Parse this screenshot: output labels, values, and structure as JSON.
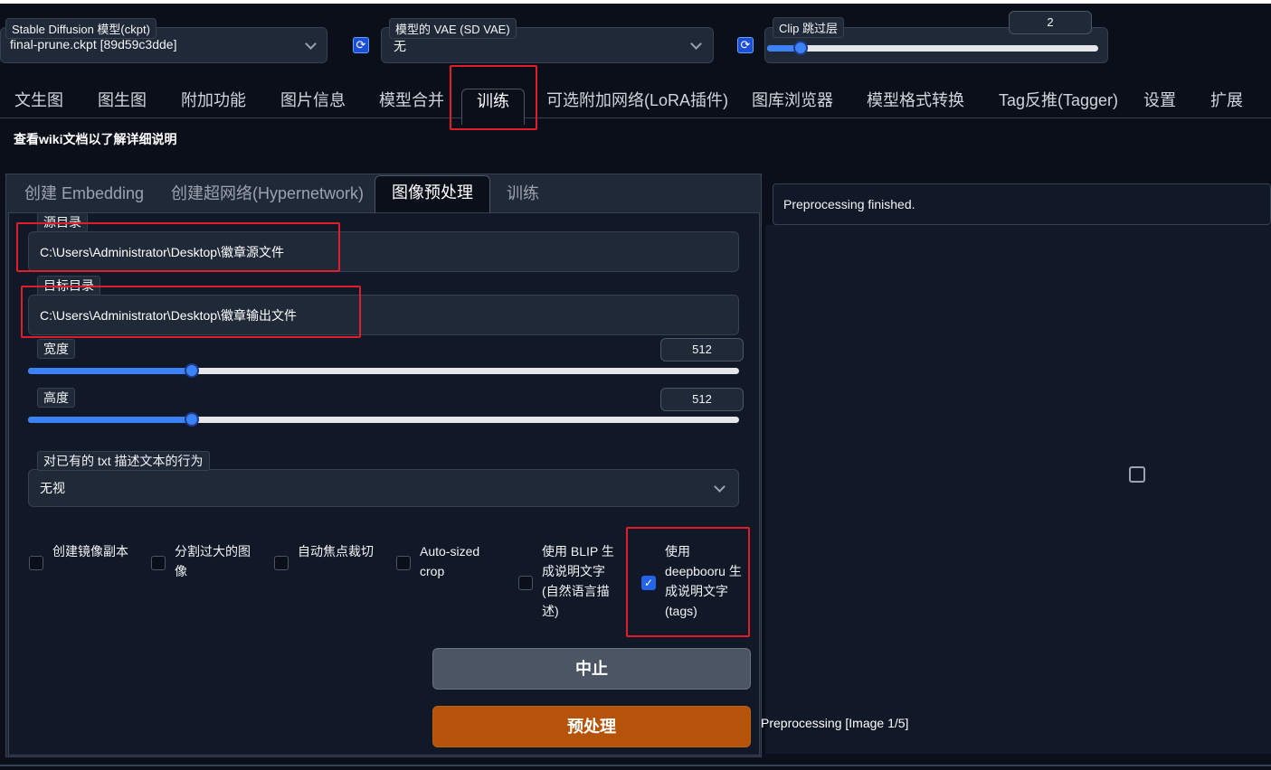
{
  "header": {
    "model_label": "Stable Diffusion 模型(ckpt)",
    "model_value": "final-prune.ckpt [89d59c3dde]",
    "vae_label": "模型的 VAE (SD VAE)",
    "vae_value": "无",
    "clip_label": "Clip 跳过层",
    "clip_value": "2",
    "clip_slider_fraction": 0.1
  },
  "main_tabs": [
    {
      "label": "文生图"
    },
    {
      "label": "图生图"
    },
    {
      "label": "附加功能"
    },
    {
      "label": "图片信息"
    },
    {
      "label": "模型合并"
    },
    {
      "label": "训练"
    },
    {
      "label": "可选附加网络(LoRA插件)"
    },
    {
      "label": "图库浏览器"
    },
    {
      "label": "模型格式转换"
    },
    {
      "label": "Tag反推(Tagger)"
    },
    {
      "label": "设置"
    },
    {
      "label": "扩展"
    }
  ],
  "active_main_tab": "训练",
  "wiki_text": "查看wiki文档以了解详细说明",
  "sub_tabs": [
    {
      "label": "创建 Embedding"
    },
    {
      "label": "创建超网络(Hypernetwork)"
    },
    {
      "label": "图像预处理"
    },
    {
      "label": "训练"
    }
  ],
  "active_sub_tab": "图像预处理",
  "preprocess": {
    "source_label": "源目录",
    "source_value": "C:\\Users\\Administrator\\Desktop\\徽章源文件",
    "target_label": "目标目录",
    "target_value": "C:\\Users\\Administrator\\Desktop\\徽章输出文件",
    "width_label": "宽度",
    "width_value": "512",
    "height_label": "高度",
    "height_value": "512",
    "size_slider_fraction": 0.23,
    "existing_caption_label": "对已有的 txt 描述文本的行为",
    "existing_caption_value": "无视",
    "checkboxes": [
      {
        "label": "创建镜像副本",
        "checked": false
      },
      {
        "label": "分割过大的图像",
        "checked": false
      },
      {
        "label": "自动焦点裁切",
        "checked": false
      },
      {
        "label": "Auto-sized crop",
        "checked": false
      },
      {
        "label": "使用 BLIP 生成说明文字(自然语言描述)",
        "checked": false
      },
      {
        "label": "使用 deepbooru 生成说明文字(tags)",
        "checked": true
      }
    ],
    "stop_button": "中止",
    "run_button": "预处理"
  },
  "output": {
    "status_text": "Preprocessing finished.",
    "progress_text": "Preprocessing [Image 1/5]"
  },
  "colors": {
    "accent": "#3b82f6",
    "highlight_box": "#e11d2a",
    "primary_button": "#b45309",
    "background": "#0b0f19"
  }
}
